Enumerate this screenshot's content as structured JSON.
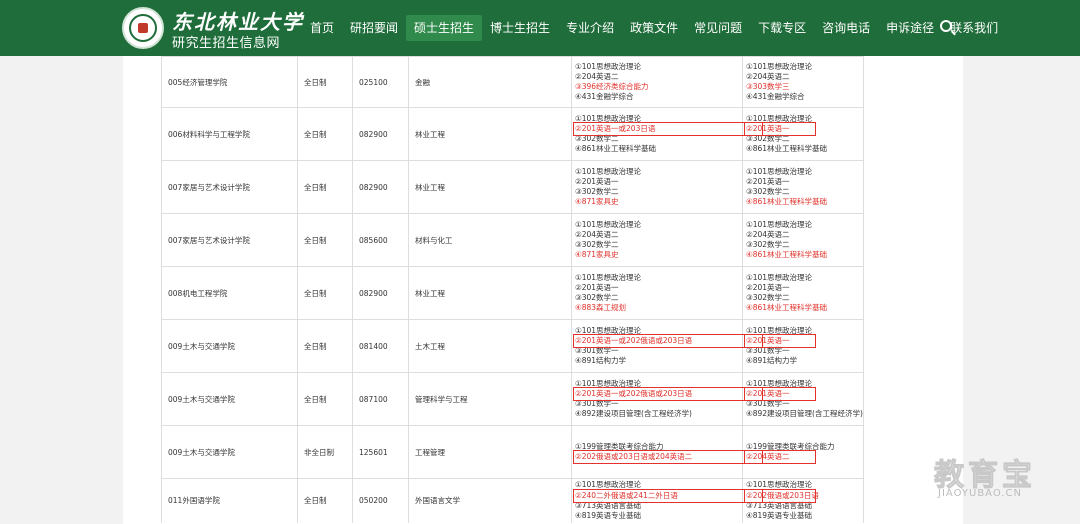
{
  "brand": {
    "title": "东北林业大学",
    "subtitle": "研究生招生信息网"
  },
  "nav": [
    {
      "label": "首页"
    },
    {
      "label": "研招要闻"
    },
    {
      "label": "硕士生招生",
      "active": true
    },
    {
      "label": "博士生招生"
    },
    {
      "label": "专业介绍"
    },
    {
      "label": "政策文件"
    },
    {
      "label": "常见问题"
    },
    {
      "label": "下载专区"
    },
    {
      "label": "咨询电话"
    },
    {
      "label": "申诉途径"
    },
    {
      "label": "联系我们"
    }
  ],
  "rows": [
    {
      "college": "005经济管理学院",
      "mode": "全日制",
      "code": "025100",
      "major": "金融",
      "exam": [
        {
          "t": "①101思想政治理论"
        },
        {
          "t": "②204英语二"
        },
        {
          "t": "③396经济类综合能力",
          "red": true
        },
        {
          "t": "④431金融学综合"
        }
      ],
      "retest": [
        {
          "t": "①101思想政治理论"
        },
        {
          "t": "②204英语二"
        },
        {
          "t": "③303数学三",
          "red": true
        },
        {
          "t": "④431金融学综合"
        }
      ]
    },
    {
      "college": "006材料科学与工程学院",
      "mode": "全日制",
      "code": "082900",
      "major": "林业工程",
      "exam": [
        {
          "t": "①101思想政治理论"
        },
        {
          "t": "②201英语一或203日语",
          "red": true
        },
        {
          "t": "③302数学二"
        },
        {
          "t": "④861林业工程科学基础"
        }
      ],
      "retest": [
        {
          "t": "①101思想政治理论"
        },
        {
          "t": "②201英语一",
          "red": true
        },
        {
          "t": "③302数学二"
        },
        {
          "t": "④861林业工程科学基础"
        }
      ]
    },
    {
      "college": "007家居与艺术设计学院",
      "mode": "全日制",
      "code": "082900",
      "major": "林业工程",
      "exam": [
        {
          "t": "①101思想政治理论"
        },
        {
          "t": "②201英语一"
        },
        {
          "t": "③302数学二"
        },
        {
          "t": "④871家具史",
          "red": true
        }
      ],
      "retest": [
        {
          "t": "①101思想政治理论"
        },
        {
          "t": "②201英语一"
        },
        {
          "t": "③302数学二"
        },
        {
          "t": "④861林业工程科学基础",
          "red": true
        }
      ]
    },
    {
      "college": "007家居与艺术设计学院",
      "mode": "全日制",
      "code": "085600",
      "major": "材料与化工",
      "exam": [
        {
          "t": "①101思想政治理论"
        },
        {
          "t": "②204英语二"
        },
        {
          "t": "③302数学二"
        },
        {
          "t": "④871家具史",
          "red": true
        }
      ],
      "retest": [
        {
          "t": "①101思想政治理论"
        },
        {
          "t": "②204英语二"
        },
        {
          "t": "③302数学二"
        },
        {
          "t": "④861林业工程科学基础",
          "red": true
        }
      ]
    },
    {
      "college": "008机电工程学院",
      "mode": "全日制",
      "code": "082900",
      "major": "林业工程",
      "exam": [
        {
          "t": "①101思想政治理论"
        },
        {
          "t": "②201英语一"
        },
        {
          "t": "③302数学二"
        },
        {
          "t": "④883森工规划",
          "red": true
        }
      ],
      "retest": [
        {
          "t": "①101思想政治理论"
        },
        {
          "t": "②201英语一"
        },
        {
          "t": "③302数学二"
        },
        {
          "t": "④861林业工程科学基础",
          "red": true
        }
      ]
    },
    {
      "college": "009土木与交通学院",
      "mode": "全日制",
      "code": "081400",
      "major": "土木工程",
      "exam": [
        {
          "t": "①101思想政治理论"
        },
        {
          "t": "②201英语一或202俄语或203日语",
          "red": true
        },
        {
          "t": "③301数学一"
        },
        {
          "t": "④891结构力学"
        }
      ],
      "retest": [
        {
          "t": "①101思想政治理论"
        },
        {
          "t": "②201英语一",
          "red": true
        },
        {
          "t": "③301数学一"
        },
        {
          "t": "④891结构力学"
        }
      ]
    },
    {
      "college": "009土木与交通学院",
      "mode": "全日制",
      "code": "087100",
      "major": "管理科学与工程",
      "exam": [
        {
          "t": "①101思想政治理论"
        },
        {
          "t": "②201英语一或202俄语或203日语",
          "red": true
        },
        {
          "t": "③301数学一"
        },
        {
          "t": "④892建设项目管理(含工程经济学)"
        }
      ],
      "retest": [
        {
          "t": "①101思想政治理论"
        },
        {
          "t": "②201英语一",
          "red": true
        },
        {
          "t": "③301数学一"
        },
        {
          "t": "④892建设项目管理(含工程经济学)"
        }
      ]
    },
    {
      "college": "009土木与交通学院",
      "mode": "非全日制",
      "code": "125601",
      "major": "工程管理",
      "exam": [
        {
          "t": "①199管理类联考综合能力"
        },
        {
          "t": "②202俄语或203日语或204英语二",
          "red": true
        }
      ],
      "retest": [
        {
          "t": "①199管理类联考综合能力"
        },
        {
          "t": "②204英语二",
          "red": true
        }
      ]
    },
    {
      "college": "011外国语学院",
      "mode": "全日制",
      "code": "050200",
      "major": "外国语言文学",
      "exam": [
        {
          "t": "①101思想政治理论"
        },
        {
          "t": "②240二外俄语或241二外日语",
          "red": true
        },
        {
          "t": "③713英语语言基础"
        },
        {
          "t": "④819英语专业基础"
        }
      ],
      "retest": [
        {
          "t": "①101思想政治理论"
        },
        {
          "t": "②202俄语或203日语",
          "red": true
        },
        {
          "t": "③713英语语言基础"
        },
        {
          "t": "④819英语专业基础"
        }
      ]
    }
  ],
  "watermark": {
    "brand": "教育宝",
    "url": "JIAOYUBAO.CN"
  }
}
